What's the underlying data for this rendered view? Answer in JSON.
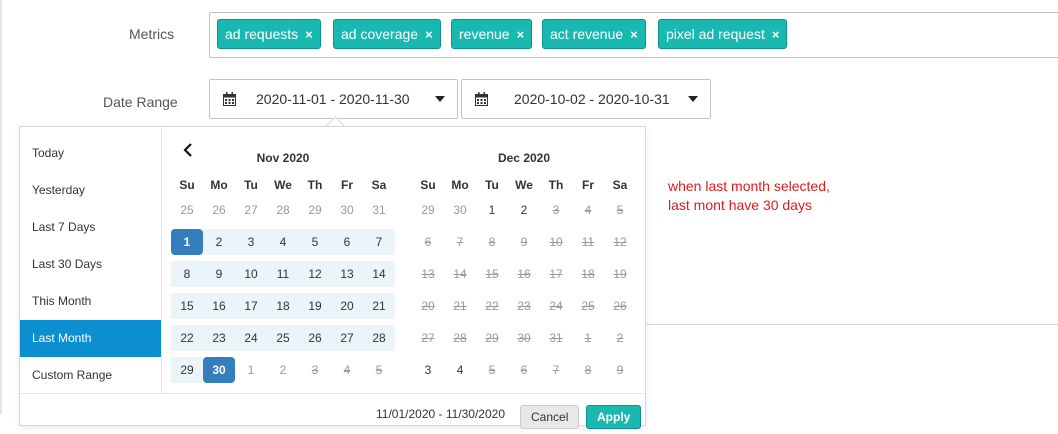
{
  "form": {
    "metrics_label": "Metrics",
    "date_range_label": "Date Range",
    "tags": [
      {
        "label": "ad requests",
        "remove": "×"
      },
      {
        "label": "ad coverage",
        "remove": "×"
      },
      {
        "label": "revenue",
        "remove": "×"
      },
      {
        "label": "act revenue",
        "remove": "×"
      },
      {
        "label": "pixel ad request",
        "remove": "×"
      }
    ],
    "date_range_1": "2020-11-01 - 2020-11-30",
    "date_range_2": "2020-10-02 - 2020-10-31"
  },
  "annotation": {
    "line1": "when last month selected,",
    "line2": "last mont have 30 days"
  },
  "picker": {
    "ranges": [
      "Today",
      "Yesterday",
      "Last 7 Days",
      "Last 30 Days",
      "This Month",
      "Last Month",
      "Custom Range"
    ],
    "active_range": "Last Month",
    "weekdays": [
      "Su",
      "Mo",
      "Tu",
      "We",
      "Th",
      "Fr",
      "Sa"
    ],
    "left_month": {
      "title": "Nov 2020",
      "weeks": [
        [
          "25",
          "26",
          "27",
          "28",
          "29",
          "30",
          "31"
        ],
        [
          "1",
          "2",
          "3",
          "4",
          "5",
          "6",
          "7"
        ],
        [
          "8",
          "9",
          "10",
          "11",
          "12",
          "13",
          "14"
        ],
        [
          "15",
          "16",
          "17",
          "18",
          "19",
          "20",
          "21"
        ],
        [
          "22",
          "23",
          "24",
          "25",
          "26",
          "27",
          "28"
        ],
        [
          "29",
          "30",
          "1",
          "2",
          "3",
          "4",
          "5"
        ]
      ]
    },
    "right_month": {
      "title": "Dec 2020",
      "weeks": [
        [
          "29",
          "30",
          "1",
          "2",
          "3",
          "4",
          "5"
        ],
        [
          "6",
          "7",
          "8",
          "9",
          "10",
          "11",
          "12"
        ],
        [
          "13",
          "14",
          "15",
          "16",
          "17",
          "18",
          "19"
        ],
        [
          "20",
          "21",
          "22",
          "23",
          "24",
          "25",
          "26"
        ],
        [
          "27",
          "28",
          "29",
          "30",
          "31",
          "1",
          "2"
        ],
        [
          "3",
          "4",
          "5",
          "6",
          "7",
          "8",
          "9"
        ]
      ]
    },
    "selected_text": "11/01/2020 - 11/30/2020",
    "cancel_label": "Cancel",
    "apply_label": "Apply"
  },
  "colors": {
    "tag_bg": "#19b9b2",
    "active_range_bg": "#0c8fd0",
    "selected_day_bg": "#357ebd",
    "in_range_bg": "#ebf4f8",
    "note_color": "#e01b1b"
  }
}
